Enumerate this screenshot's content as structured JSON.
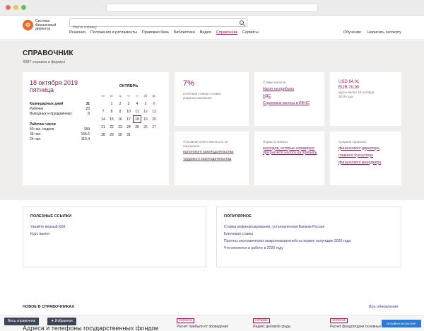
{
  "header": {
    "logo_mark": "Ф",
    "logo_text": "Система Финансовый директор",
    "search_placeholder": "Найти справку",
    "nav": [
      "Решения",
      "Положения и регламенты",
      "Правовая база",
      "Библиотека",
      "Видео",
      "Справочник",
      "Сервисы"
    ],
    "active_nav": "Справочник",
    "nav_right": [
      "Обучение",
      "Написать эксперту"
    ]
  },
  "page": {
    "title": "СПРАВОЧНИК",
    "subtitle": "4387 справок и формул"
  },
  "calendar_card": {
    "date": "18 октября 2019",
    "weekday": "пятница",
    "stats": [
      {
        "label": "Календарных дней",
        "value": "31",
        "bold": true
      },
      {
        "label": "Рабочих",
        "value": "23",
        "bold": false
      },
      {
        "label": "Выходных и праздничных",
        "value": "8",
        "bold": false
      }
    ],
    "hours_title": "Рабочих часов",
    "hours": [
      {
        "label": "40-час. неделя",
        "value": "184"
      },
      {
        "label": "36-час.",
        "value": "165.6"
      },
      {
        "label": "24-час.",
        "value": "110.4"
      }
    ],
    "month": "ОКТЯБРЬ",
    "weekdays": [
      "пн",
      "вт",
      "ср",
      "чт",
      "пт",
      "сб",
      "вс"
    ],
    "weeks": [
      [
        "",
        "1",
        "2",
        "3",
        "4",
        "5",
        "6"
      ],
      [
        "7",
        "8",
        "9",
        "10",
        "11",
        "12",
        "13"
      ],
      [
        "14",
        "15",
        "16",
        "17",
        "18",
        "19",
        "20"
      ],
      [
        "21",
        "22",
        "23",
        "24",
        "25",
        "26",
        "27"
      ],
      [
        "28",
        "29",
        "30",
        "31",
        "",
        "",
        ""
      ]
    ],
    "today": "18"
  },
  "card_rate": {
    "value": "7%",
    "caption": "ключевая ставка и ставка рефинансирования"
  },
  "card_taxes": {
    "caption": "Ставки налогов",
    "links": [
      "Налог на прибыль",
      "НДС",
      "Страховые взносы в ИФНС"
    ]
  },
  "card_currency": {
    "usd": "USD 64,01",
    "eur": "EUR 70,90",
    "caption": "курсы валют 18 октября 2019 года"
  },
  "card_liability": {
    "caption": "Уголовная ответственность за нарушения",
    "links": [
      "налогового законодательства",
      "трудового законодательства"
    ]
  },
  "card_norms": {
    "caption": "Нормы и лимиты",
    "link": "расходов, которые нормируют при расчете налога на прибыль"
  },
  "card_salary": {
    "caption": "Средние зарплаты",
    "links": [
      "финансового директора",
      "главного бухгалтера",
      "финансового менеджера"
    ]
  },
  "useful_links": {
    "title": "ПОЛЕЗНЫЕ ССЫЛКИ",
    "items": [
      "Узнайте верный КБК",
      "Курс валют"
    ]
  },
  "popular": {
    "title": "ПОПУЛЯРНОЕ",
    "items": [
      "Ставка рефинансирования, установленная Банком России",
      "Ключевая ставка",
      "Прогноз экономических макропоказателей на первое полугодие 2020 года",
      "Что меняется в работе в 2020 году"
    ]
  },
  "new_section": {
    "title": "НОВОЕ В СПРАВОЧНИКАХ",
    "all_link": "Все обновления"
  },
  "bottom_strip": {
    "title": "Адреса и телефоны государственных фондов",
    "tags": [
      "ФОРМУЛА",
      "СПРАВКА",
      "ФОРМУЛА"
    ],
    "items": [
      "Расчет прибыли от проведения",
      "Индекс деловой среды",
      "Расчет фондоотдачи основных"
    ]
  },
  "buttons": {
    "all_refs": "Весь справочник",
    "favorites": "Избранное",
    "consult": "Онлайн-консультант"
  },
  "colors": {
    "accent": "#9c1b4f",
    "link": "#3a3a9c",
    "bg_gray": "#efeeec",
    "brand_orange": "#e86a2c",
    "dark_button": "#3c4658",
    "blue_button": "#2a7ad6"
  }
}
